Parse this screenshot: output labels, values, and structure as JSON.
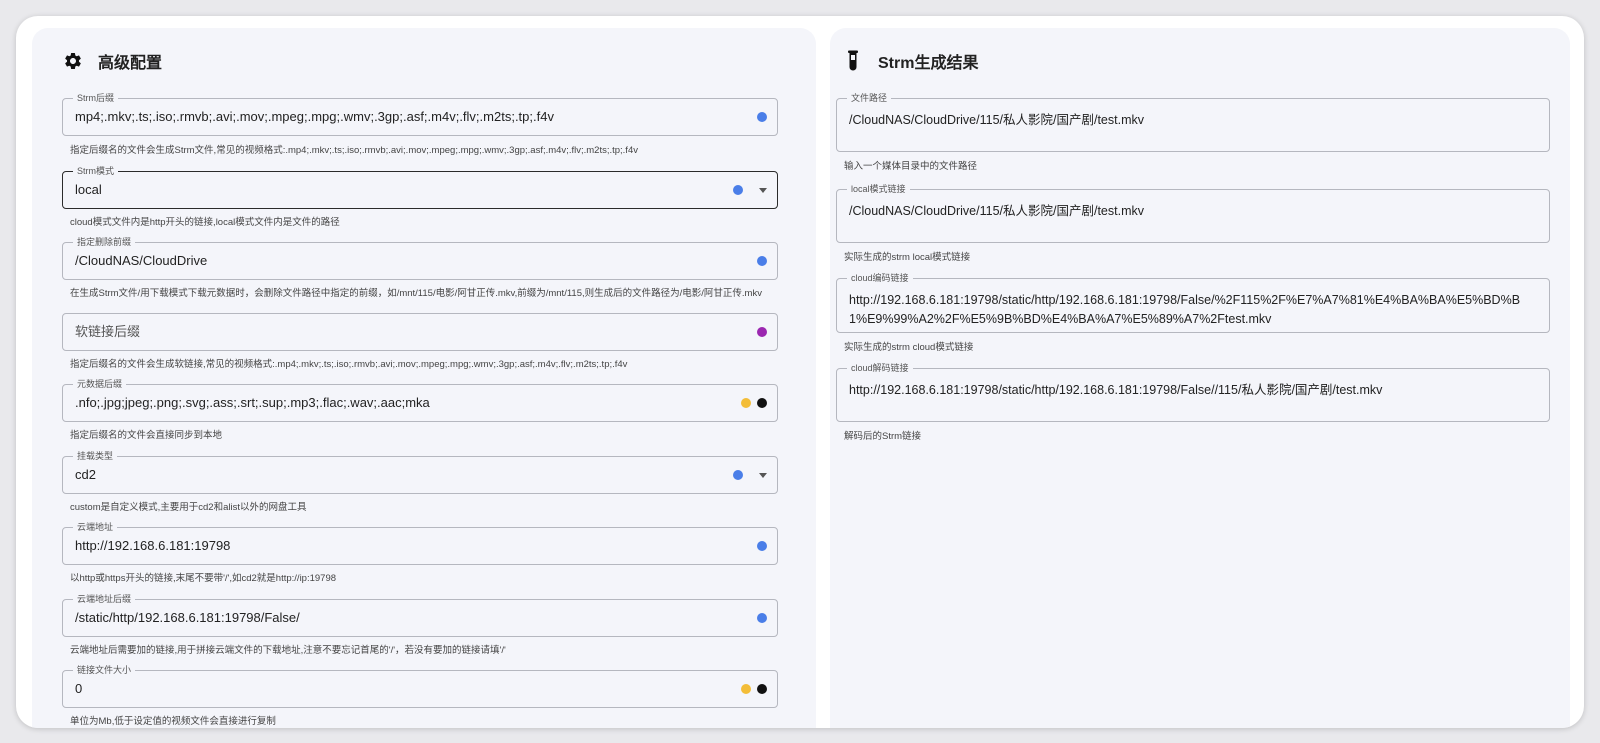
{
  "left_panel": {
    "title": "高级配置",
    "icon": "gear-icon",
    "fields": [
      {
        "label": "Strm后缀",
        "value": "mp4;.mkv;.ts;.iso;.rmvb;.avi;.mov;.mpeg;.mpg;.wmv;.3gp;.asf;.m4v;.flv;.m2ts;.tp;.f4v",
        "hint": "指定后缀名的文件会生成Strm文件,常见的视频格式:.mp4;.mkv;.ts;.iso;.rmvb;.avi;.mov;.mpeg;.mpg;.wmv;.3gp;.asf;.m4v;.flv;.m2ts;.tp;.f4v"
      },
      {
        "label": "Strm模式",
        "value": "local",
        "hint": "cloud模式文件内是http开头的链接,local模式文件内是文件的路径"
      },
      {
        "label": "指定删除前缀",
        "value": "/CloudNAS/CloudDrive",
        "hint": "在生成Strm文件/用下载模式下载元数据时，会删除文件路径中指定的前缀，如/mnt/115/电影/阿甘正传.mkv,前缀为/mnt/115,则生成后的文件路径为/电影/阿甘正传.mkv"
      },
      {
        "label": "",
        "placeholder": "软链接后缀",
        "hint": "指定后缀名的文件会生成软链接,常见的视频格式:.mp4;.mkv;.ts;.iso;.rmvb;.avi;.mov;.mpeg;.mpg;.wmv;.3gp;.asf;.m4v;.flv;.m2ts;.tp;.f4v"
      },
      {
        "label": "元数据后缀",
        "value": ".nfo;.jpg;jpeg;.png;.svg;.ass;.srt;.sup;.mp3;.flac;.wav;.aac;mka",
        "hint": "指定后缀名的文件会直接同步到本地"
      },
      {
        "label": "挂载类型",
        "value": "cd2",
        "hint": "custom是自定义模式,主要用于cd2和alist以外的网盘工具"
      },
      {
        "label": "云端地址",
        "value": "http://192.168.6.181:19798",
        "hint": "以http或https开头的链接,末尾不要带'/',如cd2就是http://ip:19798"
      },
      {
        "label": "云端地址后缀",
        "value": "/static/http/192.168.6.181:19798/False/",
        "hint": "云端地址后需要加的链接,用于拼接云端文件的下载地址,注意不要忘记首尾的'/'，若没有要加的链接请填'/'"
      },
      {
        "label": "链接文件大小",
        "value": "0",
        "hint": "单位为Mb,低于设定值的视频文件会直接进行复制"
      }
    ]
  },
  "right_panel": {
    "title": "Strm生成结果",
    "icon": "test-tube-icon",
    "fields": [
      {
        "label": "文件路径",
        "value": "/CloudNAS/CloudDrive/115/私人影院/国产剧/test.mkv",
        "hint": "输入一个媒体目录中的文件路径"
      },
      {
        "label": "local模式链接",
        "value": "/CloudNAS/CloudDrive/115/私人影院/国产剧/test.mkv",
        "hint": "实际生成的strm local模式链接"
      },
      {
        "label": "cloud编码链接",
        "value": "http://192.168.6.181:19798/static/http/192.168.6.181:19798/False/%2F115%2F%E7%A7%81%E4%BA%BA%E5%BD%B1%E9%99%A2%2F%E5%9B%BD%E4%BA%A7%E5%89%A7%2Ftest.mkv",
        "hint": "实际生成的strm cloud模式链接"
      },
      {
        "label": "cloud解码链接",
        "value": "http://192.168.6.181:19798/static/http/192.168.6.181:19798/False//115/私人影院/国产剧/test.mkv",
        "hint": "解码后的Strm链接"
      }
    ]
  },
  "colors": {
    "blue_dot": "#4a7ee8",
    "purple_dot": "#9b27b0",
    "yellow_dot": "#f3bd38",
    "black_dot": "#111111"
  }
}
